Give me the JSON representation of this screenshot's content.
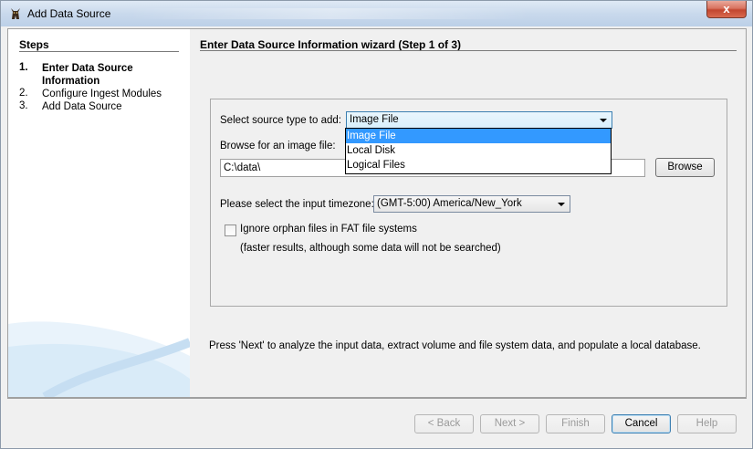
{
  "window": {
    "title": "Add Data Source",
    "close_label": "x"
  },
  "steps": {
    "title": "Steps",
    "items": [
      {
        "num": "1.",
        "label": "Enter Data Source Information",
        "active": true
      },
      {
        "num": "2.",
        "label": "Configure Ingest Modules",
        "active": false
      },
      {
        "num": "3.",
        "label": "Add Data Source",
        "active": false
      }
    ]
  },
  "wizard": {
    "title": "Enter Data Source Information wizard (Step 1 of 3)",
    "source_type_label": "Select source type to add:",
    "source_type_value": "Image File",
    "source_type_options": [
      "Image File",
      "Local Disk",
      "Logical Files"
    ],
    "browse_label": "Browse for an image file:",
    "path_value": "C:\\data\\",
    "browse_button": "Browse",
    "timezone_label": "Please select the input timezone:",
    "timezone_value": "(GMT-5:00) America/New_York",
    "orphan_label": "Ignore orphan files in FAT file systems",
    "orphan_note": "(faster results, although some data will not be searched)",
    "orphan_checked": false,
    "next_hint": "Press 'Next' to analyze the input data, extract volume and file system data, and populate a local database."
  },
  "buttons": {
    "back": "< Back",
    "next": "Next >",
    "finish": "Finish",
    "cancel": "Cancel",
    "help": "Help"
  }
}
